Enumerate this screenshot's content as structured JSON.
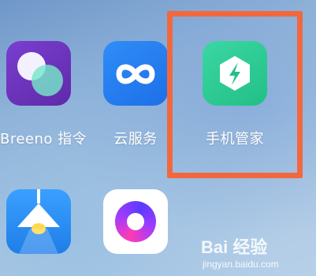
{
  "apps": {
    "breeno": {
      "label": "Breeno 指令",
      "icon": "breeno-icon"
    },
    "cloud": {
      "label": "云服务",
      "icon": "cloud-infinity-icon"
    },
    "manager": {
      "label": "手机管家",
      "icon": "shield-lightning-icon"
    },
    "lamp": {
      "label": "",
      "icon": "lamp-icon"
    },
    "ring": {
      "label": "",
      "icon": "purple-ring-icon"
    }
  },
  "highlight_color": "#f2683e",
  "watermark": {
    "logo": "Bai 经验",
    "url": "jingyan.baidu.com"
  }
}
